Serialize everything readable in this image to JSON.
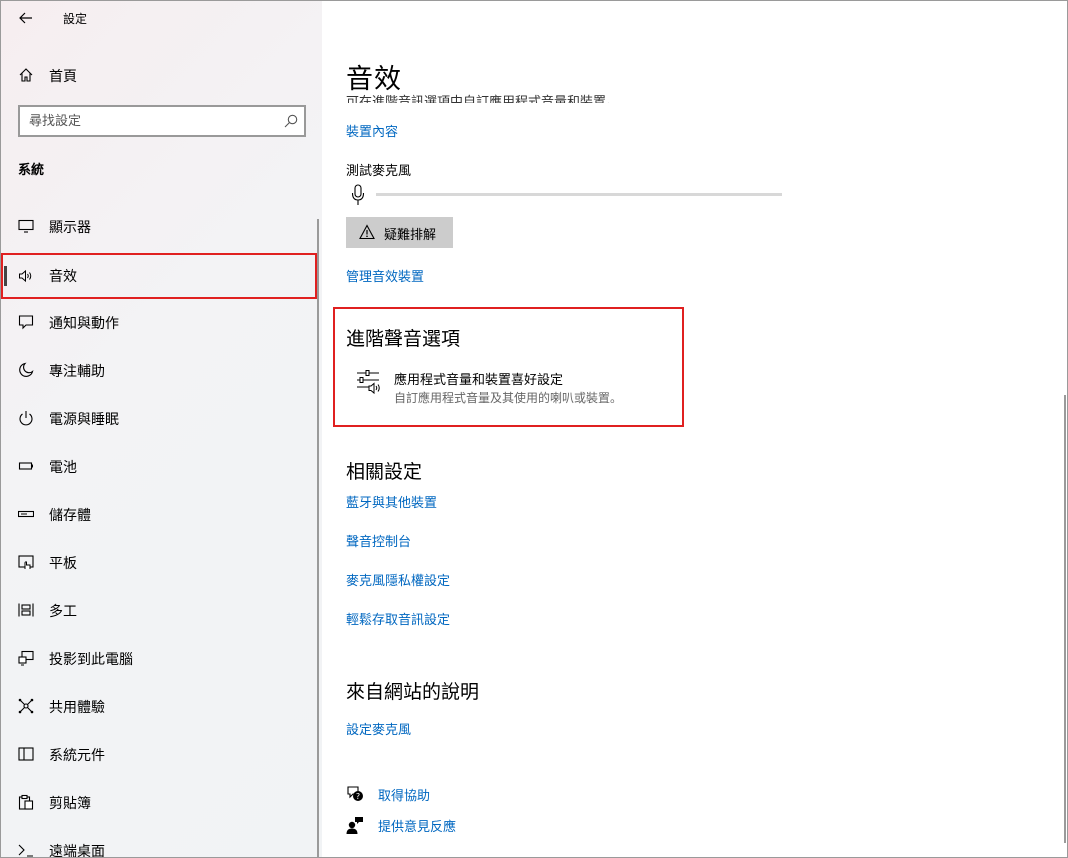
{
  "window": {
    "title": "設定",
    "controls": {
      "minimize": "minimize-icon",
      "maximize": "maximize-icon",
      "close": "close-icon"
    }
  },
  "sidebar": {
    "home_label": "首頁",
    "search_placeholder": "尋找設定",
    "section_label": "系統",
    "items": [
      {
        "label": "顯示器",
        "icon": "monitor-icon"
      },
      {
        "label": "音效",
        "icon": "speaker-icon",
        "selected": true
      },
      {
        "label": "通知與動作",
        "icon": "notification-icon"
      },
      {
        "label": "專注輔助",
        "icon": "moon-icon"
      },
      {
        "label": "電源與睡眠",
        "icon": "power-icon"
      },
      {
        "label": "電池",
        "icon": "battery-icon"
      },
      {
        "label": "儲存體",
        "icon": "storage-icon"
      },
      {
        "label": "平板",
        "icon": "tablet-icon"
      },
      {
        "label": "多工",
        "icon": "multitasking-icon"
      },
      {
        "label": "投影到此電腦",
        "icon": "projecting-icon"
      },
      {
        "label": "共用體驗",
        "icon": "shared-experiences-icon"
      },
      {
        "label": "系統元件",
        "icon": "system-components-icon"
      },
      {
        "label": "剪貼簿",
        "icon": "clipboard-icon"
      },
      {
        "label": "遠端桌面",
        "icon": "remote-desktop-icon"
      }
    ]
  },
  "main": {
    "title": "音效",
    "clipped_text": "可在進階音訊選項中自訂應用程式音量和裝置。",
    "device_properties_link": "裝置內容",
    "test_mic_label": "測試麥克風",
    "mic_level": 0,
    "troubleshoot_label": "疑難排解",
    "manage_devices_link": "管理音效裝置",
    "advanced": {
      "heading": "進階聲音選項",
      "item_title": "應用程式音量和裝置喜好設定",
      "item_desc": "自訂應用程式音量及其使用的喇叭或裝置。"
    },
    "related": {
      "heading": "相關設定",
      "links": [
        "藍牙與其他裝置",
        "聲音控制台",
        "麥克風隱私權設定",
        "輕鬆存取音訊設定"
      ]
    },
    "web_help": {
      "heading": "來自網站的說明",
      "links": [
        "設定麥克風"
      ]
    },
    "help": {
      "get_help": "取得協助",
      "feedback": "提供意見反應"
    }
  },
  "colors": {
    "accent": "#0067c0",
    "highlight": "#e02020",
    "button_bg": "#cccccc"
  }
}
